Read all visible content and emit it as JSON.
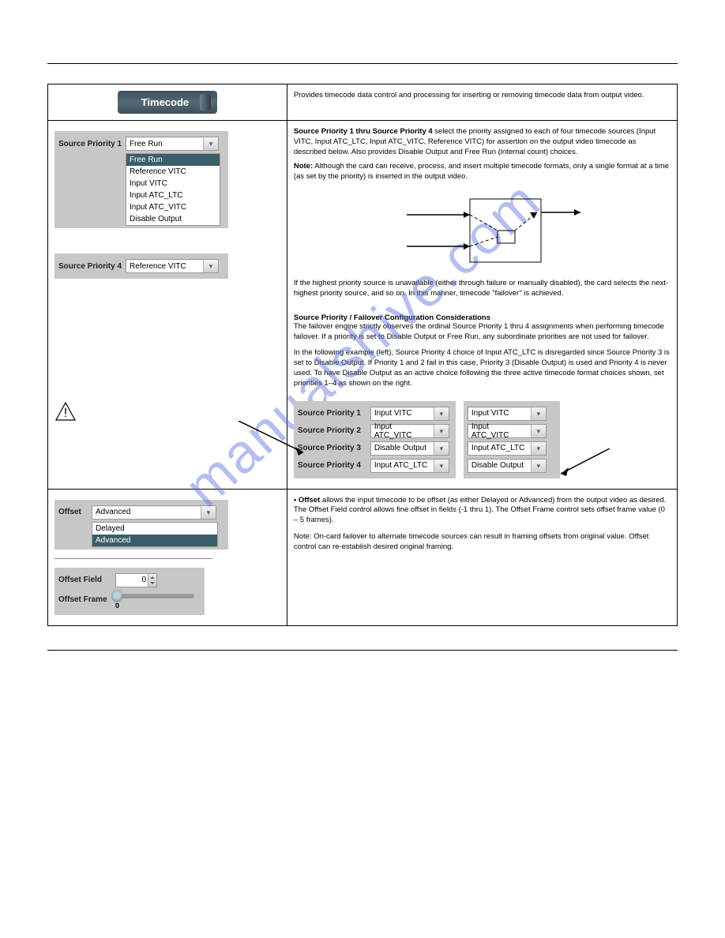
{
  "watermark": "manualshive.com",
  "header": {
    "tab_label": "Timecode"
  },
  "right_header_text": "Provides timecode data control and processing for inserting or removing timecode data from output video.",
  "source_priority_block": {
    "sp1": {
      "label": "Source Priority 1",
      "value": "Free Run",
      "options": [
        "Free Run",
        "Reference VITC",
        "Input VITC",
        "Input ATC_LTC",
        "Input ATC_VITC",
        "Disable Output"
      ]
    },
    "sp4": {
      "label": "Source Priority 4",
      "value": "Reference VITC"
    }
  },
  "right_body": {
    "sp_head": "Source Priority 1 thru Source Priority 4",
    "sp_text": " select the priority assigned to each of four timecode sources (Input VITC, Input ATC_LTC, Input ATC_VITC, Reference VITC) for assertion on the output video timecode as described below. Also provides Disable Output and Free Run (internal count) choices.",
    "note_head": "Note:",
    "note_text": " Although the card can receive, process, and insert multiple timecode formats, only a single format at a time (as set by the priority) is inserted in the output video.",
    "diag_caption": "If the highest priority source is unavailable (either through failure or manually disabled), the card selects the next-highest priority source, and so on. In this manner, timecode \"failover\" is achieved.",
    "caution_head": "Source Priority / Failover Configuration Considerations",
    "caution_text": "The failover engine strictly observes the ordinal Source Priority 1 thru 4 assignments when performing timecode failover. If a priority is set to Disable Output or Free Run, any subordinate priorities are not used for failover.",
    "example_lead": "In the following example (left), Source Priority 4 choice of Input ATC_LTC is disregarded since Source Priority 3 is set to Disable Output. If Priority 1 and 2 fail in this case, Priority 3 (Disable Output) is used and Priority 4 is never used. To have Disable Output as an active choice following the three active timecode format choices shown, set priorities 1–4 as shown on the right."
  },
  "example_columns": {
    "left": {
      "rows": [
        {
          "label": "Source Priority 1",
          "value": "Input VITC"
        },
        {
          "label": "Source Priority 2",
          "value": "Input ATC_VITC"
        },
        {
          "label": "Source Priority 3",
          "value": "Disable Output"
        },
        {
          "label": "Source Priority 4",
          "value": "Input ATC_LTC"
        }
      ]
    },
    "right": {
      "rows": [
        {
          "label": "",
          "value": "Input VITC"
        },
        {
          "label": "",
          "value": "Input ATC_VITC"
        },
        {
          "label": "",
          "value": "Input ATC_LTC"
        },
        {
          "label": "",
          "value": "Disable Output"
        }
      ]
    }
  },
  "offset_block": {
    "label": "Offset",
    "value": "Advanced",
    "options": [
      "Delayed",
      "Advanced"
    ],
    "field_label": "Offset Field",
    "field_value": "0",
    "frame_label": "Offset Frame",
    "frame_value": "0"
  },
  "offset_right": {
    "head_field": "• Offset",
    "text_field": " allows the input timecode to be offset (as either Delayed or Advanced) from the output video as desired. The Offset Field control allows fine offset in fields (-1 thru 1). The Offset Frame control sets offset frame value (0 – 5 frames).",
    "note": "Note: On-card failover to alternate timecode sources can result in framing offsets from original value. Offset control can re-establish desired original framing."
  }
}
